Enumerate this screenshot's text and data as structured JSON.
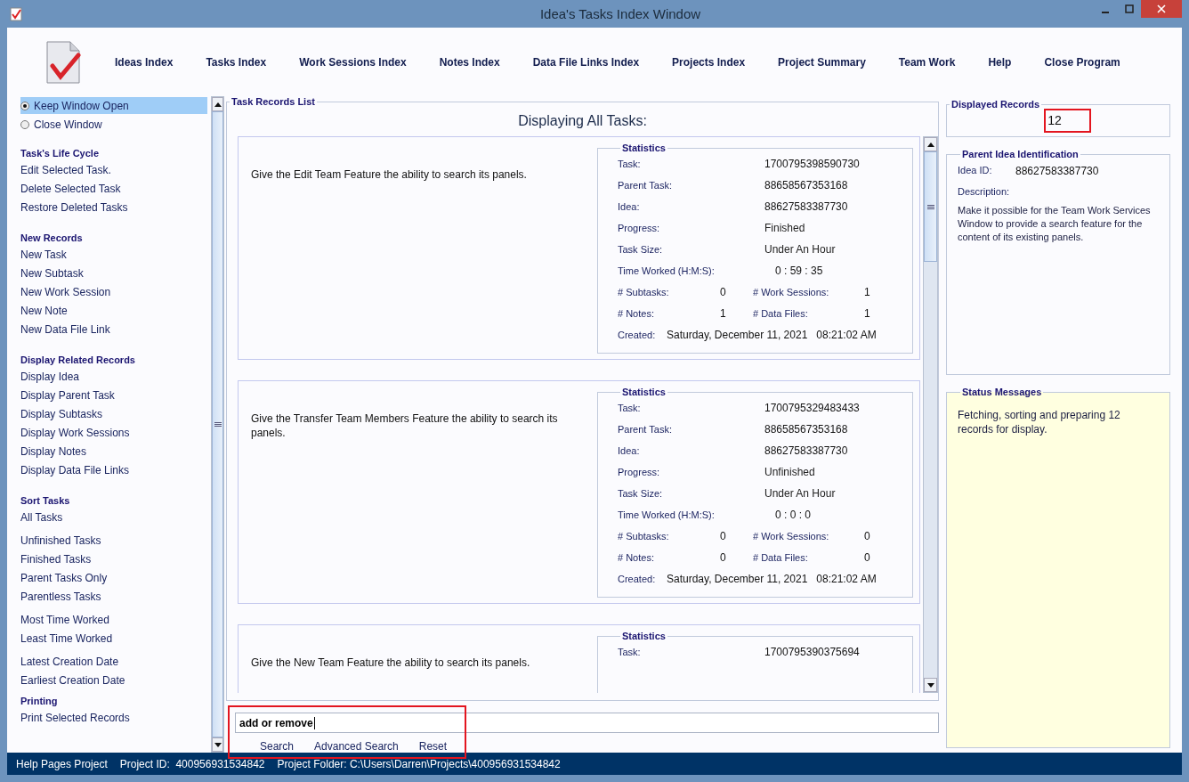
{
  "window": {
    "title": "Idea's Tasks Index Window"
  },
  "nav": [
    "Ideas Index",
    "Tasks Index",
    "Work Sessions Index",
    "Notes Index",
    "Data File Links Index",
    "Projects Index",
    "Project Summary",
    "Team Work",
    "Help",
    "Close Program"
  ],
  "window_options": [
    {
      "label": "Keep Window Open",
      "selected": true
    },
    {
      "label": "Close Window",
      "selected": false
    }
  ],
  "sidebar": [
    {
      "kind": "heading",
      "label": "Task's Life Cycle"
    },
    {
      "kind": "link",
      "label": "Edit Selected Task."
    },
    {
      "kind": "link",
      "label": "Delete Selected Task"
    },
    {
      "kind": "link",
      "label": "Restore Deleted Tasks"
    },
    {
      "kind": "heading",
      "label": "New Records"
    },
    {
      "kind": "link",
      "label": "New Task"
    },
    {
      "kind": "link",
      "label": "New Subtask"
    },
    {
      "kind": "link",
      "label": "New Work Session"
    },
    {
      "kind": "link",
      "label": "New Note"
    },
    {
      "kind": "link",
      "label": "New Data File Link"
    },
    {
      "kind": "heading",
      "label": "Display Related Records"
    },
    {
      "kind": "link",
      "label": "Display Idea"
    },
    {
      "kind": "link",
      "label": "Display Parent Task"
    },
    {
      "kind": "link",
      "label": "Display Subtasks"
    },
    {
      "kind": "link",
      "label": "Display Work Sessions"
    },
    {
      "kind": "link",
      "label": "Display Notes"
    },
    {
      "kind": "link",
      "label": "Display Data File Links"
    },
    {
      "kind": "heading",
      "label": "Sort Tasks"
    },
    {
      "kind": "link",
      "label": "All Tasks"
    },
    {
      "kind": "spacer-link",
      "label": "Unfinished Tasks"
    },
    {
      "kind": "link",
      "label": "Finished Tasks"
    },
    {
      "kind": "link",
      "label": "Parent Tasks Only"
    },
    {
      "kind": "link",
      "label": "Parentless Tasks"
    },
    {
      "kind": "spacer-link",
      "label": "Most Time Worked"
    },
    {
      "kind": "link",
      "label": "Least Time Worked"
    },
    {
      "kind": "spacer-link",
      "label": "Latest Creation Date"
    },
    {
      "kind": "link",
      "label": "Earliest Creation Date"
    },
    {
      "kind": "heading-tight",
      "label": "Printing"
    },
    {
      "kind": "link",
      "label": "Print Selected Records"
    }
  ],
  "records": {
    "title": "Task Records List",
    "heading": "Displaying All Tasks:",
    "tasks": [
      {
        "description": "Give the Edit Team Feature the ability to search its panels.",
        "stats_title": "Statistics",
        "stats": [
          {
            "kind": "single",
            "label": "Task:",
            "value": "1700795398590730"
          },
          {
            "kind": "single",
            "label": "Parent Task:",
            "value": "88658567353168"
          },
          {
            "kind": "single",
            "label": "Idea:",
            "value": "88627583387730"
          },
          {
            "kind": "single-large",
            "label": "Progress:",
            "value": "Finished"
          },
          {
            "kind": "single-large",
            "label": "Task Size:",
            "value": "Under An Hour"
          },
          {
            "kind": "time",
            "label": "Time Worked (H:M:S):",
            "value": "0  : 59 : 35"
          },
          {
            "kind": "pair",
            "label": "# Subtasks:",
            "value": "0",
            "label2": "# Work Sessions:",
            "value2": "1"
          },
          {
            "kind": "pair",
            "label": "# Notes:",
            "value": "1",
            "label2": "# Data Files:",
            "value2": "1"
          },
          {
            "kind": "created",
            "label": "Created:",
            "value": "Saturday, December 11, 2021   08:21:02 AM"
          }
        ]
      },
      {
        "description": "Give the Transfer Team Members Feature the ability to search its panels.",
        "stats_title": "Statistics",
        "stats": [
          {
            "kind": "single",
            "label": "Task:",
            "value": "1700795329483433"
          },
          {
            "kind": "single",
            "label": "Parent Task:",
            "value": "88658567353168"
          },
          {
            "kind": "single",
            "label": "Idea:",
            "value": "88627583387730"
          },
          {
            "kind": "single-large",
            "label": "Progress:",
            "value": "Unfinished"
          },
          {
            "kind": "single-large",
            "label": "Task Size:",
            "value": "Under An Hour"
          },
          {
            "kind": "time",
            "label": "Time Worked (H:M:S):",
            "value": "0  :  0  :  0"
          },
          {
            "kind": "pair",
            "label": "# Subtasks:",
            "value": "0",
            "label2": "# Work Sessions:",
            "value2": "0"
          },
          {
            "kind": "pair",
            "label": "# Notes:",
            "value": "0",
            "label2": "# Data Files:",
            "value2": "0"
          },
          {
            "kind": "created",
            "label": "Created:",
            "value": "Saturday, December 11, 2021   08:21:02 AM"
          }
        ]
      },
      {
        "description": "Give the New Team Feature the ability to search its panels.",
        "stats_title": "Statistics",
        "stats": [
          {
            "kind": "single",
            "label": "Task:",
            "value": "1700795390375694"
          }
        ]
      }
    ]
  },
  "search": {
    "value": "add or remove",
    "buttons": [
      "Search",
      "Advanced Search",
      "Reset"
    ]
  },
  "displayed_records": {
    "title": "Displayed Records",
    "count": "12"
  },
  "parent_idea": {
    "title": "Parent Idea Identification",
    "id_label": "Idea ID:",
    "id": "88627583387730",
    "description_label": "Description:",
    "description": "Make it possible for the Team Work Services Window to provide a search feature for the content of its existing panels."
  },
  "status_messages": {
    "title": "Status Messages",
    "text": "Fetching, sorting and preparing 12 records for display."
  },
  "status_bar": [
    "Help Pages Project",
    "Project ID:  400956931534842",
    "Project Folder: C:\\Users\\Darren\\Projects\\400956931534842"
  ]
}
